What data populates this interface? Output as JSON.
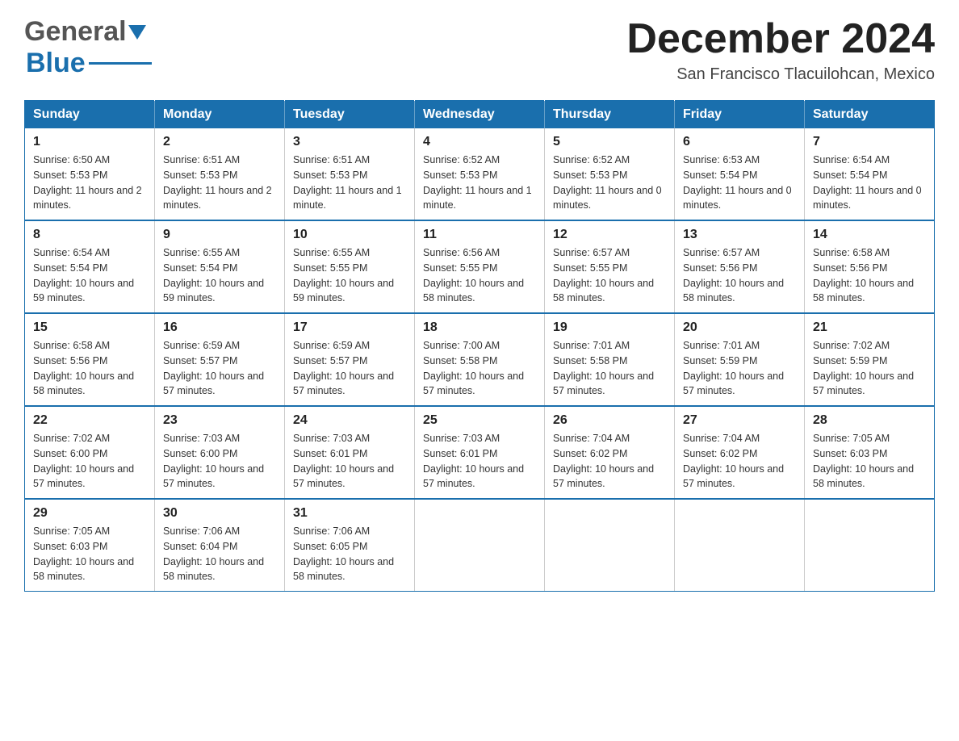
{
  "header": {
    "logo_text_general": "General",
    "logo_text_blue": "Blue",
    "month_title": "December 2024",
    "subtitle": "San Francisco Tlacuilohcan, Mexico"
  },
  "calendar": {
    "headers": [
      "Sunday",
      "Monday",
      "Tuesday",
      "Wednesday",
      "Thursday",
      "Friday",
      "Saturday"
    ],
    "weeks": [
      [
        {
          "day": "1",
          "sunrise": "6:50 AM",
          "sunset": "5:53 PM",
          "daylight": "11 hours and 2 minutes."
        },
        {
          "day": "2",
          "sunrise": "6:51 AM",
          "sunset": "5:53 PM",
          "daylight": "11 hours and 2 minutes."
        },
        {
          "day": "3",
          "sunrise": "6:51 AM",
          "sunset": "5:53 PM",
          "daylight": "11 hours and 1 minute."
        },
        {
          "day": "4",
          "sunrise": "6:52 AM",
          "sunset": "5:53 PM",
          "daylight": "11 hours and 1 minute."
        },
        {
          "day": "5",
          "sunrise": "6:52 AM",
          "sunset": "5:53 PM",
          "daylight": "11 hours and 0 minutes."
        },
        {
          "day": "6",
          "sunrise": "6:53 AM",
          "sunset": "5:54 PM",
          "daylight": "11 hours and 0 minutes."
        },
        {
          "day": "7",
          "sunrise": "6:54 AM",
          "sunset": "5:54 PM",
          "daylight": "11 hours and 0 minutes."
        }
      ],
      [
        {
          "day": "8",
          "sunrise": "6:54 AM",
          "sunset": "5:54 PM",
          "daylight": "10 hours and 59 minutes."
        },
        {
          "day": "9",
          "sunrise": "6:55 AM",
          "sunset": "5:54 PM",
          "daylight": "10 hours and 59 minutes."
        },
        {
          "day": "10",
          "sunrise": "6:55 AM",
          "sunset": "5:55 PM",
          "daylight": "10 hours and 59 minutes."
        },
        {
          "day": "11",
          "sunrise": "6:56 AM",
          "sunset": "5:55 PM",
          "daylight": "10 hours and 58 minutes."
        },
        {
          "day": "12",
          "sunrise": "6:57 AM",
          "sunset": "5:55 PM",
          "daylight": "10 hours and 58 minutes."
        },
        {
          "day": "13",
          "sunrise": "6:57 AM",
          "sunset": "5:56 PM",
          "daylight": "10 hours and 58 minutes."
        },
        {
          "day": "14",
          "sunrise": "6:58 AM",
          "sunset": "5:56 PM",
          "daylight": "10 hours and 58 minutes."
        }
      ],
      [
        {
          "day": "15",
          "sunrise": "6:58 AM",
          "sunset": "5:56 PM",
          "daylight": "10 hours and 58 minutes."
        },
        {
          "day": "16",
          "sunrise": "6:59 AM",
          "sunset": "5:57 PM",
          "daylight": "10 hours and 57 minutes."
        },
        {
          "day": "17",
          "sunrise": "6:59 AM",
          "sunset": "5:57 PM",
          "daylight": "10 hours and 57 minutes."
        },
        {
          "day": "18",
          "sunrise": "7:00 AM",
          "sunset": "5:58 PM",
          "daylight": "10 hours and 57 minutes."
        },
        {
          "day": "19",
          "sunrise": "7:01 AM",
          "sunset": "5:58 PM",
          "daylight": "10 hours and 57 minutes."
        },
        {
          "day": "20",
          "sunrise": "7:01 AM",
          "sunset": "5:59 PM",
          "daylight": "10 hours and 57 minutes."
        },
        {
          "day": "21",
          "sunrise": "7:02 AM",
          "sunset": "5:59 PM",
          "daylight": "10 hours and 57 minutes."
        }
      ],
      [
        {
          "day": "22",
          "sunrise": "7:02 AM",
          "sunset": "6:00 PM",
          "daylight": "10 hours and 57 minutes."
        },
        {
          "day": "23",
          "sunrise": "7:03 AM",
          "sunset": "6:00 PM",
          "daylight": "10 hours and 57 minutes."
        },
        {
          "day": "24",
          "sunrise": "7:03 AM",
          "sunset": "6:01 PM",
          "daylight": "10 hours and 57 minutes."
        },
        {
          "day": "25",
          "sunrise": "7:03 AM",
          "sunset": "6:01 PM",
          "daylight": "10 hours and 57 minutes."
        },
        {
          "day": "26",
          "sunrise": "7:04 AM",
          "sunset": "6:02 PM",
          "daylight": "10 hours and 57 minutes."
        },
        {
          "day": "27",
          "sunrise": "7:04 AM",
          "sunset": "6:02 PM",
          "daylight": "10 hours and 57 minutes."
        },
        {
          "day": "28",
          "sunrise": "7:05 AM",
          "sunset": "6:03 PM",
          "daylight": "10 hours and 58 minutes."
        }
      ],
      [
        {
          "day": "29",
          "sunrise": "7:05 AM",
          "sunset": "6:03 PM",
          "daylight": "10 hours and 58 minutes."
        },
        {
          "day": "30",
          "sunrise": "7:06 AM",
          "sunset": "6:04 PM",
          "daylight": "10 hours and 58 minutes."
        },
        {
          "day": "31",
          "sunrise": "7:06 AM",
          "sunset": "6:05 PM",
          "daylight": "10 hours and 58 minutes."
        },
        null,
        null,
        null,
        null
      ]
    ]
  }
}
